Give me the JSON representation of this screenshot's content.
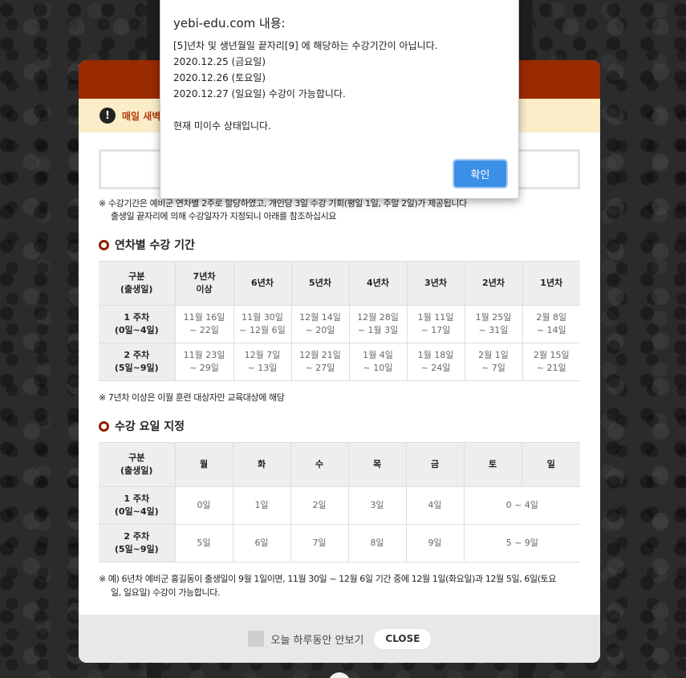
{
  "popup": {
    "notice_text": "매일 새벽",
    "notice_icon": "exclamation-icon",
    "description": [
      "※ 수강기간은 예비군 연차별 2주로 할당하였고, 개인당 3일 수강 기회(평일 1일, 주말 2일)가 제공됩니다",
      "출생일 끝자리에 의해 수강일자가 지정되니 아래를 참조하십시요"
    ],
    "section1_title": "연차별 수강 기간",
    "table1": {
      "header_first": [
        "구분",
        "(출생일)"
      ],
      "columns": [
        [
          "7년차",
          "이상"
        ],
        [
          "6년차"
        ],
        [
          "5년차"
        ],
        [
          "4년차"
        ],
        [
          "3년차"
        ],
        [
          "2년차"
        ],
        [
          "1년차"
        ]
      ],
      "rows": [
        {
          "label": [
            "1 주차",
            "(0일~4일)"
          ],
          "cells": [
            [
              "11월 16일",
              "~ 22일"
            ],
            [
              "11월 30일",
              "~ 12월 6일"
            ],
            [
              "12월 14일",
              "~ 20일"
            ],
            [
              "12월 28일",
              "~ 1월 3일"
            ],
            [
              "1월 11일",
              "~ 17일"
            ],
            [
              "1월 25일",
              "~ 31일"
            ],
            [
              "2월 8일",
              "~ 14일"
            ]
          ]
        },
        {
          "label": [
            "2 주차",
            "(5일~9일)"
          ],
          "cells": [
            [
              "11월 23일",
              "~ 29일"
            ],
            [
              "12월 7일",
              "~ 13일"
            ],
            [
              "12월 21일",
              "~ 27일"
            ],
            [
              "1월 4일",
              "~ 10일"
            ],
            [
              "1월 18일",
              "~ 24일"
            ],
            [
              "2월 1일",
              "~ 7일"
            ],
            [
              "2월 15일",
              "~ 21일"
            ]
          ]
        }
      ]
    },
    "note1": "※ 7년차 이상은 이월 훈련 대상자만 교육대상에 해당",
    "section2_title": "수강 요일 지정",
    "table2": {
      "header_first": [
        "구분",
        "(출생일)"
      ],
      "columns": [
        "월",
        "화",
        "수",
        "목",
        "금",
        "토",
        "일"
      ],
      "rows": [
        {
          "label": [
            "1 주차",
            "(0일~4일)"
          ],
          "cells": [
            "0일",
            "1일",
            "2일",
            "3일",
            "4일"
          ],
          "weekend": "0 ~ 4일"
        },
        {
          "label": [
            "2 주차",
            "(5일~9일)"
          ],
          "cells": [
            "5일",
            "6일",
            "7일",
            "8일",
            "9일"
          ],
          "weekend": "5 ~ 9일"
        }
      ]
    },
    "note2": [
      "※ 예) 6년차 예비군 홍길동이 출생일이 9월 1일이면, 11월 30일 ~ 12월 6일 기간 중에 12월 1일(화요일)과 12월 5일, 6일(토요",
      "일, 일요일) 수강이 가능합니다."
    ],
    "footer": {
      "checkbox_label": "오늘 하루동안 안보기",
      "close_label": "CLOSE"
    }
  },
  "alert": {
    "title": "yebi-edu.com 내용:",
    "lines": [
      "[5]년차 및 생년월일 끝자리[9] 에 해당하는 수강기간이 아닙니다.",
      "2020.12.25 (금요일)",
      "2020.12.26 (토요일)",
      "2020.12.27 (일요일) 수강이 가능합니다."
    ],
    "status": "현재 미이수 상태입니다.",
    "ok_label": "확인"
  },
  "colors": {
    "header": "#9a2a00",
    "notice_bg": "#fbedc7",
    "ok_button": "#3c8fe6"
  }
}
